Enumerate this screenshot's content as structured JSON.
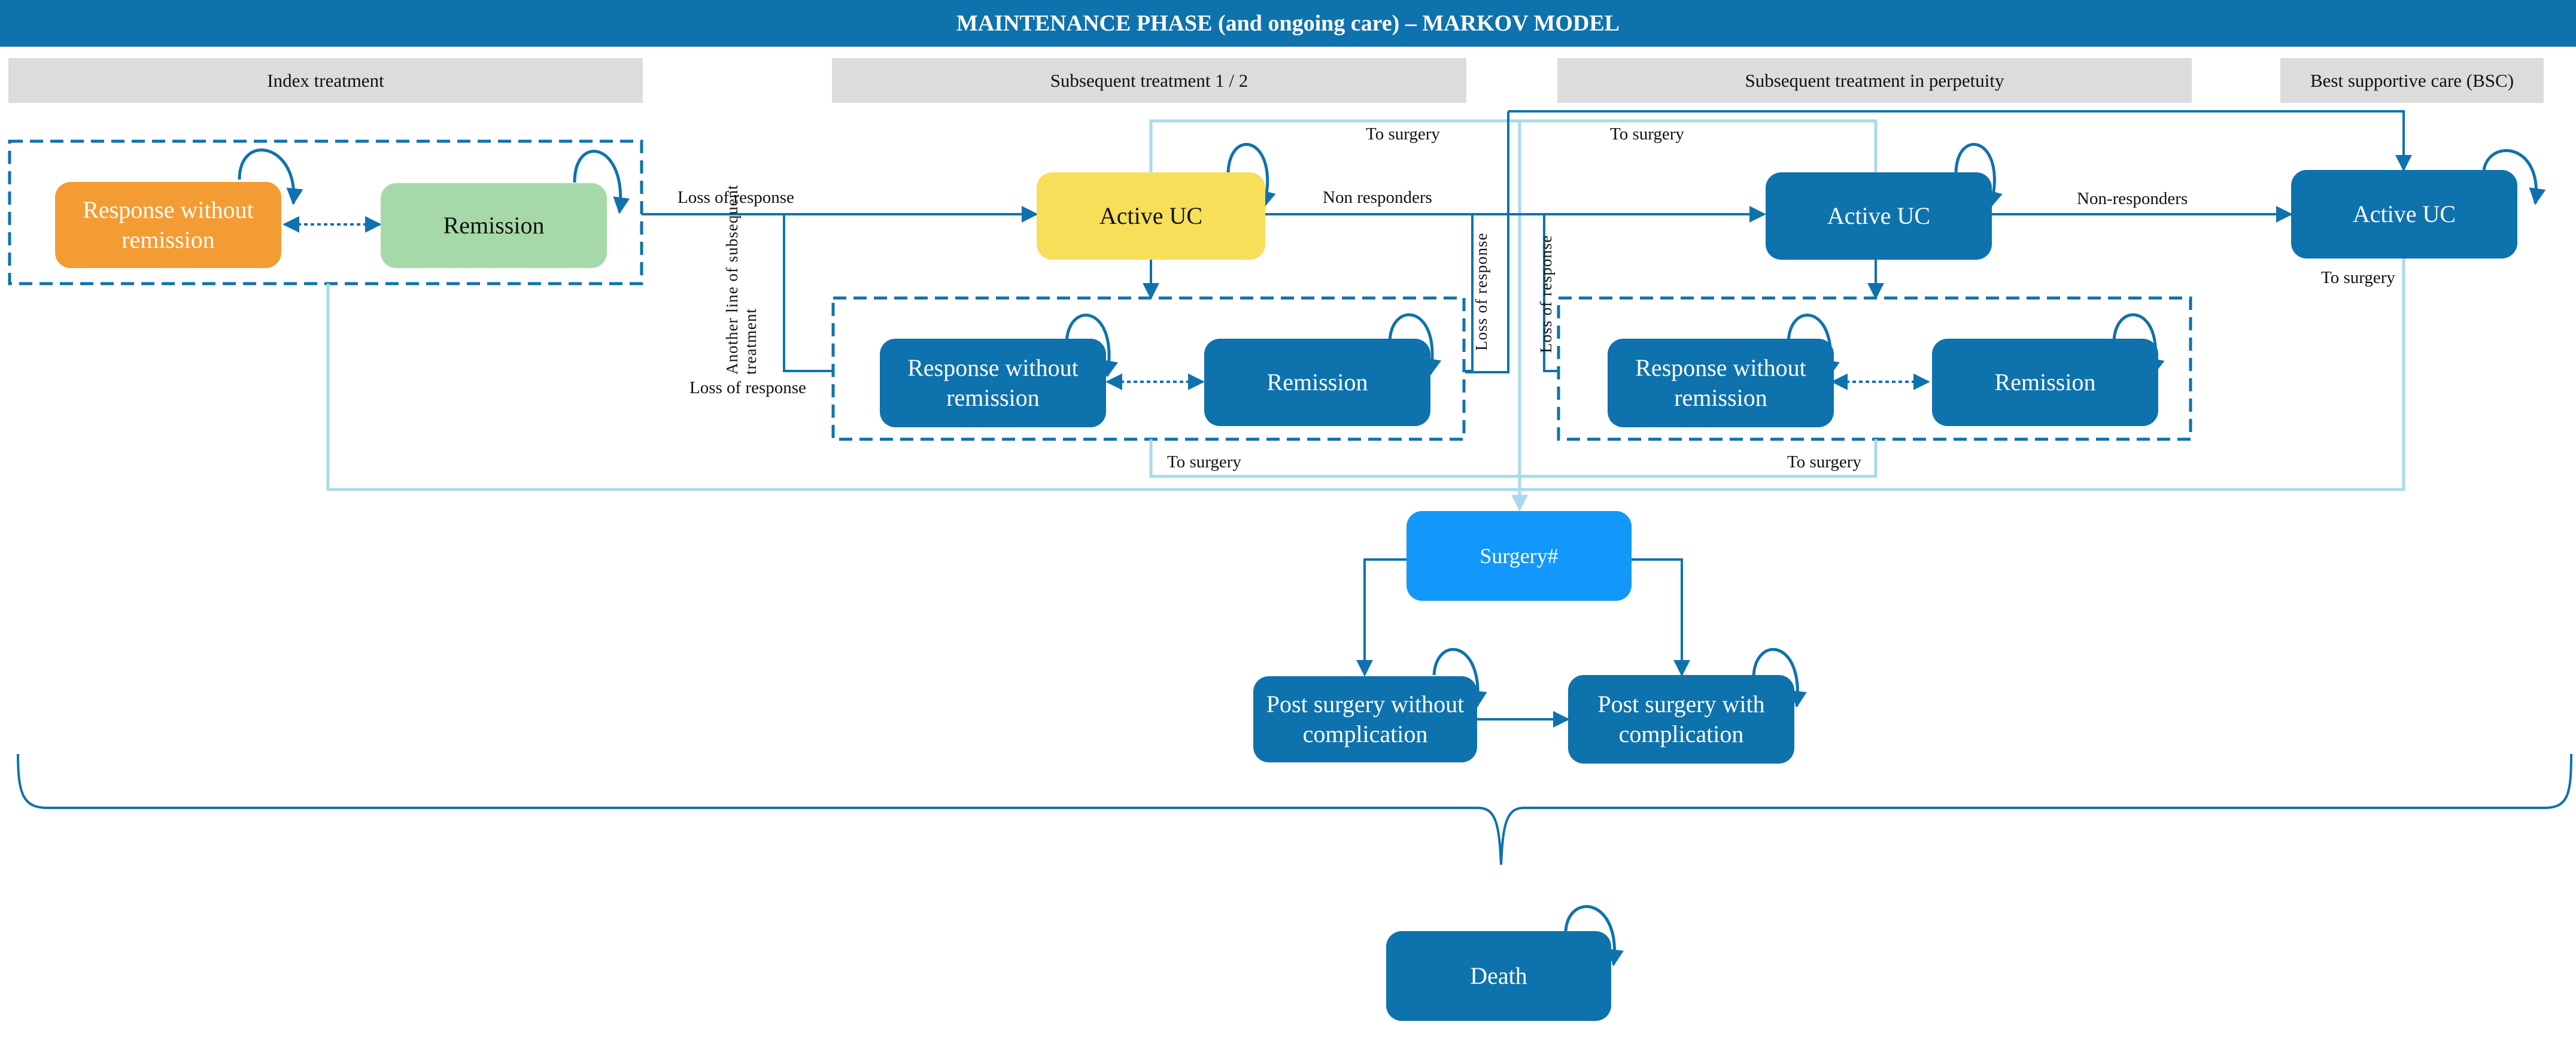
{
  "header": {
    "title": "MAINTENANCE  PHASE (and ongoing care) – MARKOV MODEL"
  },
  "phases": [
    {
      "label": "Index treatment"
    },
    {
      "label": "Subsequent treatment 1 / 2"
    },
    {
      "label": "Subsequent treatment in perpetuity"
    },
    {
      "label": "Best supportive care (BSC)"
    }
  ],
  "nodes": {
    "index_response": "Response without remission",
    "index_remission": "Remission",
    "sub12_active": "Active UC",
    "sub12_response": "Response without remission",
    "sub12_remission": "Remission",
    "perp_active": "Active UC",
    "perp_response": "Response without remission",
    "perp_remission": "Remission",
    "bsc_active": "Active UC",
    "surgery": "Surgery#",
    "post_without": "Post surgery without complication",
    "post_with": "Post surgery with complication",
    "death": "Death"
  },
  "edge_labels": {
    "loss_of_response_top": "Loss of response",
    "another_line": "Another line of subsequent treatment",
    "loss_of_response_bottom": "Loss of response",
    "non_responders_1": "Non responders",
    "non_responders_2": "Non-responders",
    "loss_of_response_v1": "Loss of response",
    "loss_of_response_v2": "Loss of response",
    "to_surgery_1": "To surgery",
    "to_surgery_2": "To surgery",
    "to_surgery_3": "To surgery",
    "to_surgery_4": "To surgery",
    "to_surgery_bsc": "To surgery"
  },
  "colors": {
    "primary": "#0e72ad",
    "light_wire": "#a9dbe8",
    "orange": "#f39c34",
    "green": "#a6d9a9",
    "yellow": "#f7df5a",
    "surgery": "#1297fa",
    "phase_bg": "#dcdcdc"
  }
}
